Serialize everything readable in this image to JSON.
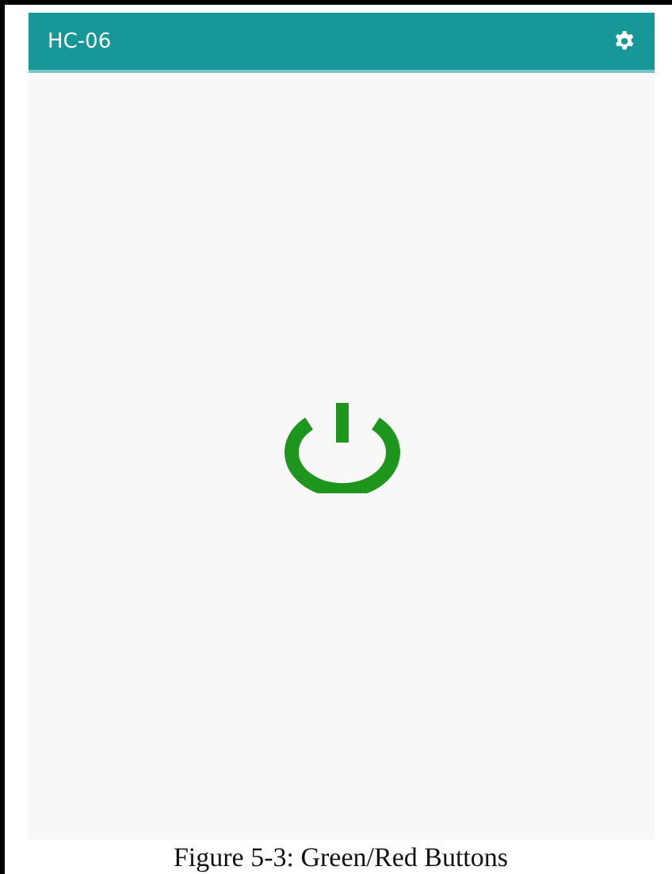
{
  "app_bar": {
    "title": "HC-06"
  },
  "power_button": {
    "on": true
  },
  "caption": "Figure 5-3: Green/Red Buttons"
}
